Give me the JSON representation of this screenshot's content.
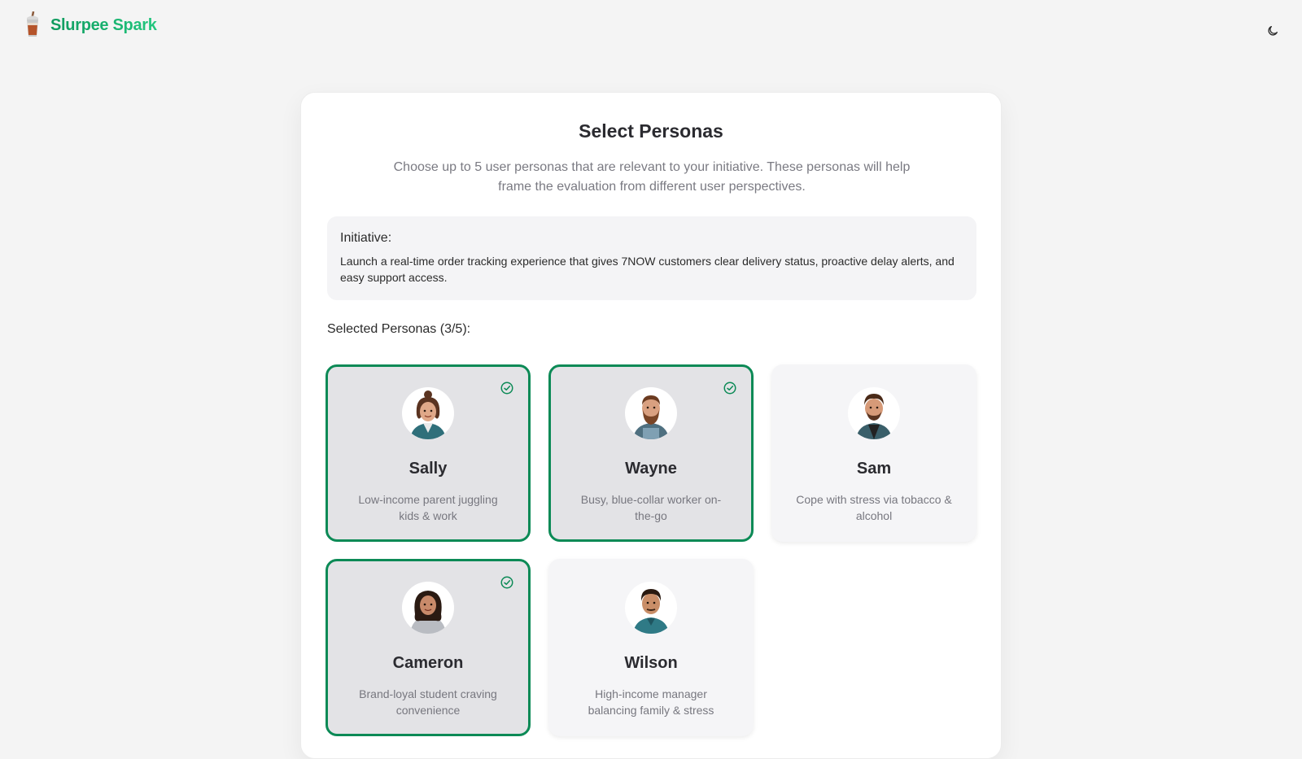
{
  "app": {
    "brand": "Slurpee Spark",
    "brand_color": "#12a864",
    "accent": "#0c8a56"
  },
  "header": {
    "theme_toggle_icon": "moon-icon"
  },
  "page": {
    "title": "Select Personas",
    "subtitle": "Choose up to 5 user personas that are relevant to your initiative. These personas will help frame the evaluation from different user perspectives.",
    "initiative_label": "Initiative:",
    "initiative_text": "Launch a real-time order tracking experience that gives 7NOW customers clear delivery status, proactive delay alerts, and easy support access.",
    "selected_label": "Selected Personas (3/5):"
  },
  "personas": [
    {
      "name": "Sally",
      "description": "Low-income parent juggling kids & work",
      "selected": true
    },
    {
      "name": "Wayne",
      "description": "Busy, blue-collar worker on-the-go",
      "selected": true
    },
    {
      "name": "Sam",
      "description": "Cope with stress via tobacco & alcohol",
      "selected": false
    },
    {
      "name": "Cameron",
      "description": "Brand-loyal student craving convenience",
      "selected": true
    },
    {
      "name": "Wilson",
      "description": "High-income manager balancing family & stress",
      "selected": false
    }
  ]
}
